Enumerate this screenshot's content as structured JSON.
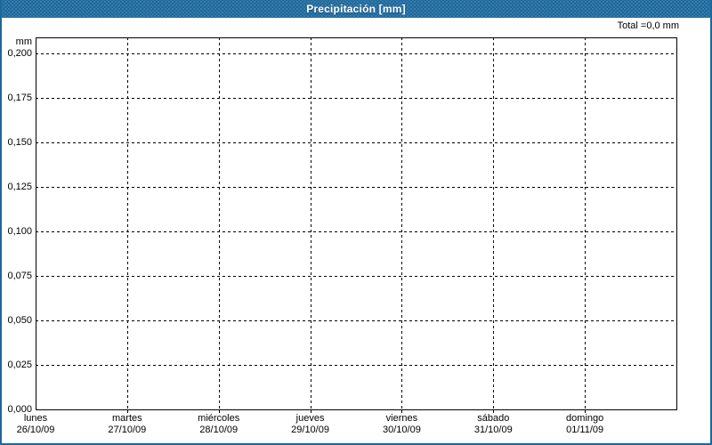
{
  "window": {
    "title": "Precipitación [mm]",
    "total_label": "Total =0,0 mm",
    "unit_label": "mm",
    "colors": {
      "header_bg": "#1c689c",
      "header_text": "#ffffff",
      "frame_border": "#1c689c",
      "plot_border": "#000000",
      "gridline": "#000000",
      "label_text": "#000000",
      "background": "#ffffff"
    }
  },
  "chart_data": {
    "type": "bar",
    "title": "Precipitación [mm]",
    "ylabel": "mm",
    "xlabel": "",
    "total_annotation": "Total =0,0 mm",
    "ylim": [
      0,
      0.209
    ],
    "grid": "both-dashed",
    "legend": "none",
    "yticks": [
      {
        "label": "0,200",
        "value": 0.2
      },
      {
        "label": "0,175",
        "value": 0.175
      },
      {
        "label": "0,150",
        "value": 0.15
      },
      {
        "label": "0,125",
        "value": 0.125
      },
      {
        "label": "0,100",
        "value": 0.1
      },
      {
        "label": "0,075",
        "value": 0.075
      },
      {
        "label": "0,050",
        "value": 0.05
      },
      {
        "label": "0,025",
        "value": 0.025
      },
      {
        "label": "0,000",
        "value": 0.0
      }
    ],
    "categories": [
      {
        "day": "lunes",
        "date": "26/10/09"
      },
      {
        "day": "martes",
        "date": "27/10/09"
      },
      {
        "day": "miércoles",
        "date": "28/10/09"
      },
      {
        "day": "jueves",
        "date": "29/10/09"
      },
      {
        "day": "viernes",
        "date": "30/10/09"
      },
      {
        "day": "sábado",
        "date": "31/10/09"
      },
      {
        "day": "domingo",
        "date": "01/11/09"
      }
    ],
    "values": [
      0,
      0,
      0,
      0,
      0,
      0,
      0
    ]
  }
}
